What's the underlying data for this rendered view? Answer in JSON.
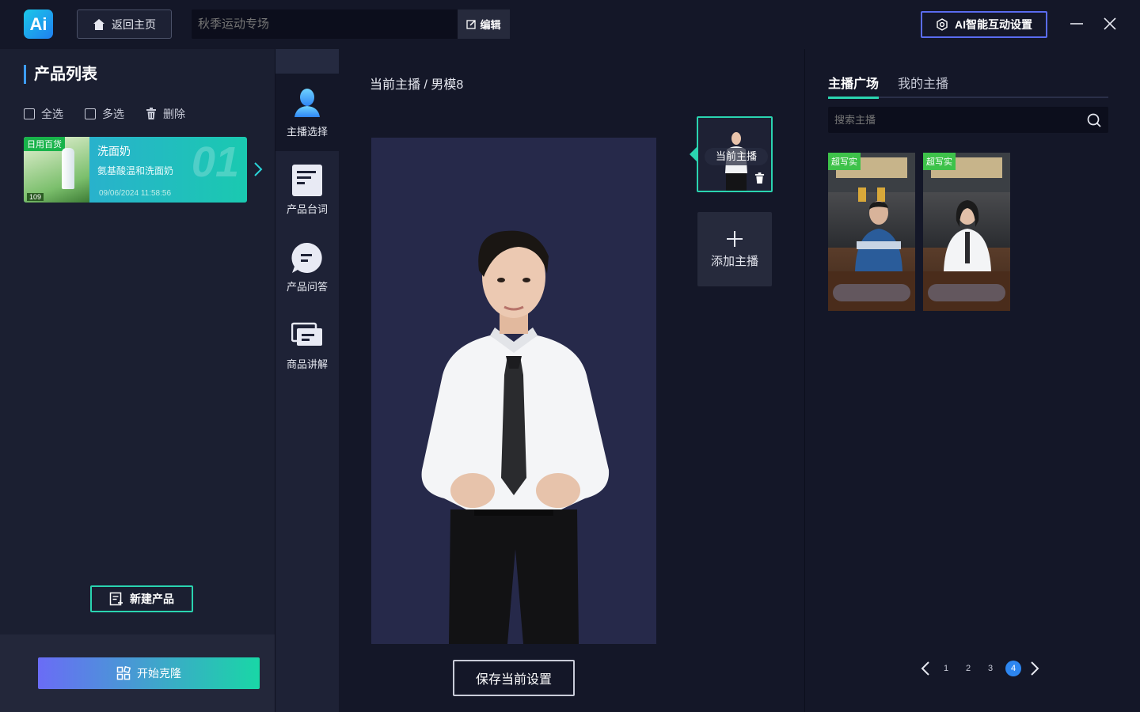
{
  "header": {
    "logo_text": "Ai",
    "home_label": "返回主页",
    "title_placeholder": "秋季运动专场",
    "edit_label": "编辑",
    "ai_settings_label": "AI智能互动设置"
  },
  "left": {
    "title": "产品列表",
    "select_all": "全选",
    "multi_select": "多选",
    "delete": "删除",
    "products": [
      {
        "tag": "日用百货",
        "name": "洗面奶",
        "desc": "氨基酸温和洗面奶",
        "date": "09/06/2024 11:58:56",
        "index": "01",
        "price": "109"
      }
    ],
    "new_product": "新建产品",
    "start_clone": "开始克隆"
  },
  "nav": {
    "items": [
      {
        "label": "主播选择",
        "icon": "person-icon"
      },
      {
        "label": "产品台词",
        "icon": "document-icon"
      },
      {
        "label": "产品问答",
        "icon": "chat-icon"
      },
      {
        "label": "商品讲解",
        "icon": "slides-icon"
      }
    ]
  },
  "center": {
    "breadcrumb": "当前主播 / 男模8",
    "current_anchor_label": "当前主播",
    "add_anchor": "添加主播",
    "save": "保存当前设置"
  },
  "right": {
    "tabs": [
      "主播广场",
      "我的主播"
    ],
    "search_placeholder": "搜索主播",
    "anchors": [
      {
        "tag": "超写实"
      },
      {
        "tag": "超写实"
      }
    ],
    "pages": [
      "1",
      "2",
      "3",
      "4"
    ],
    "current_page": "4"
  },
  "colors": {
    "accent_teal": "#2ad4b0",
    "accent_blue": "#5a6cf0",
    "background": "#141728",
    "page_active": "#2d86f0"
  }
}
